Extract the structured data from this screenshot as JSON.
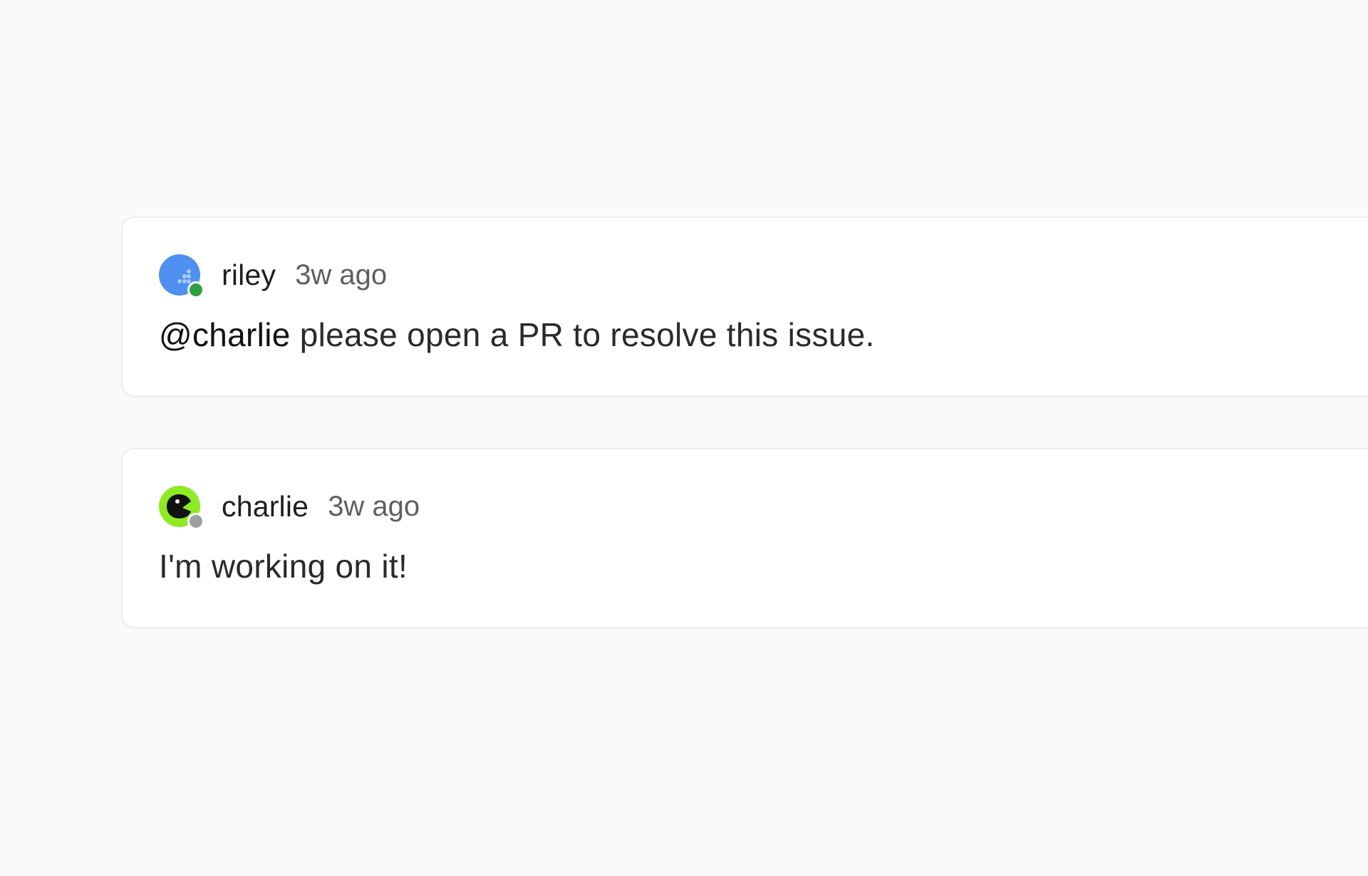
{
  "comments": [
    {
      "author": "riley",
      "timestamp": "3w ago",
      "avatar": {
        "icon": "dots-avatar-icon",
        "color": "#4f8ff0"
      },
      "presence": {
        "status": "online",
        "color": "#2ea043"
      },
      "mention": "@charlie",
      "body": " please open a PR to resolve this issue."
    },
    {
      "author": "charlie",
      "timestamp": "3w ago",
      "avatar": {
        "icon": "creature-avatar-icon",
        "color": "#8eea22"
      },
      "presence": {
        "status": "offline",
        "color": "#9e9e9e"
      },
      "mention": "",
      "body": "I'm working on it!"
    }
  ]
}
